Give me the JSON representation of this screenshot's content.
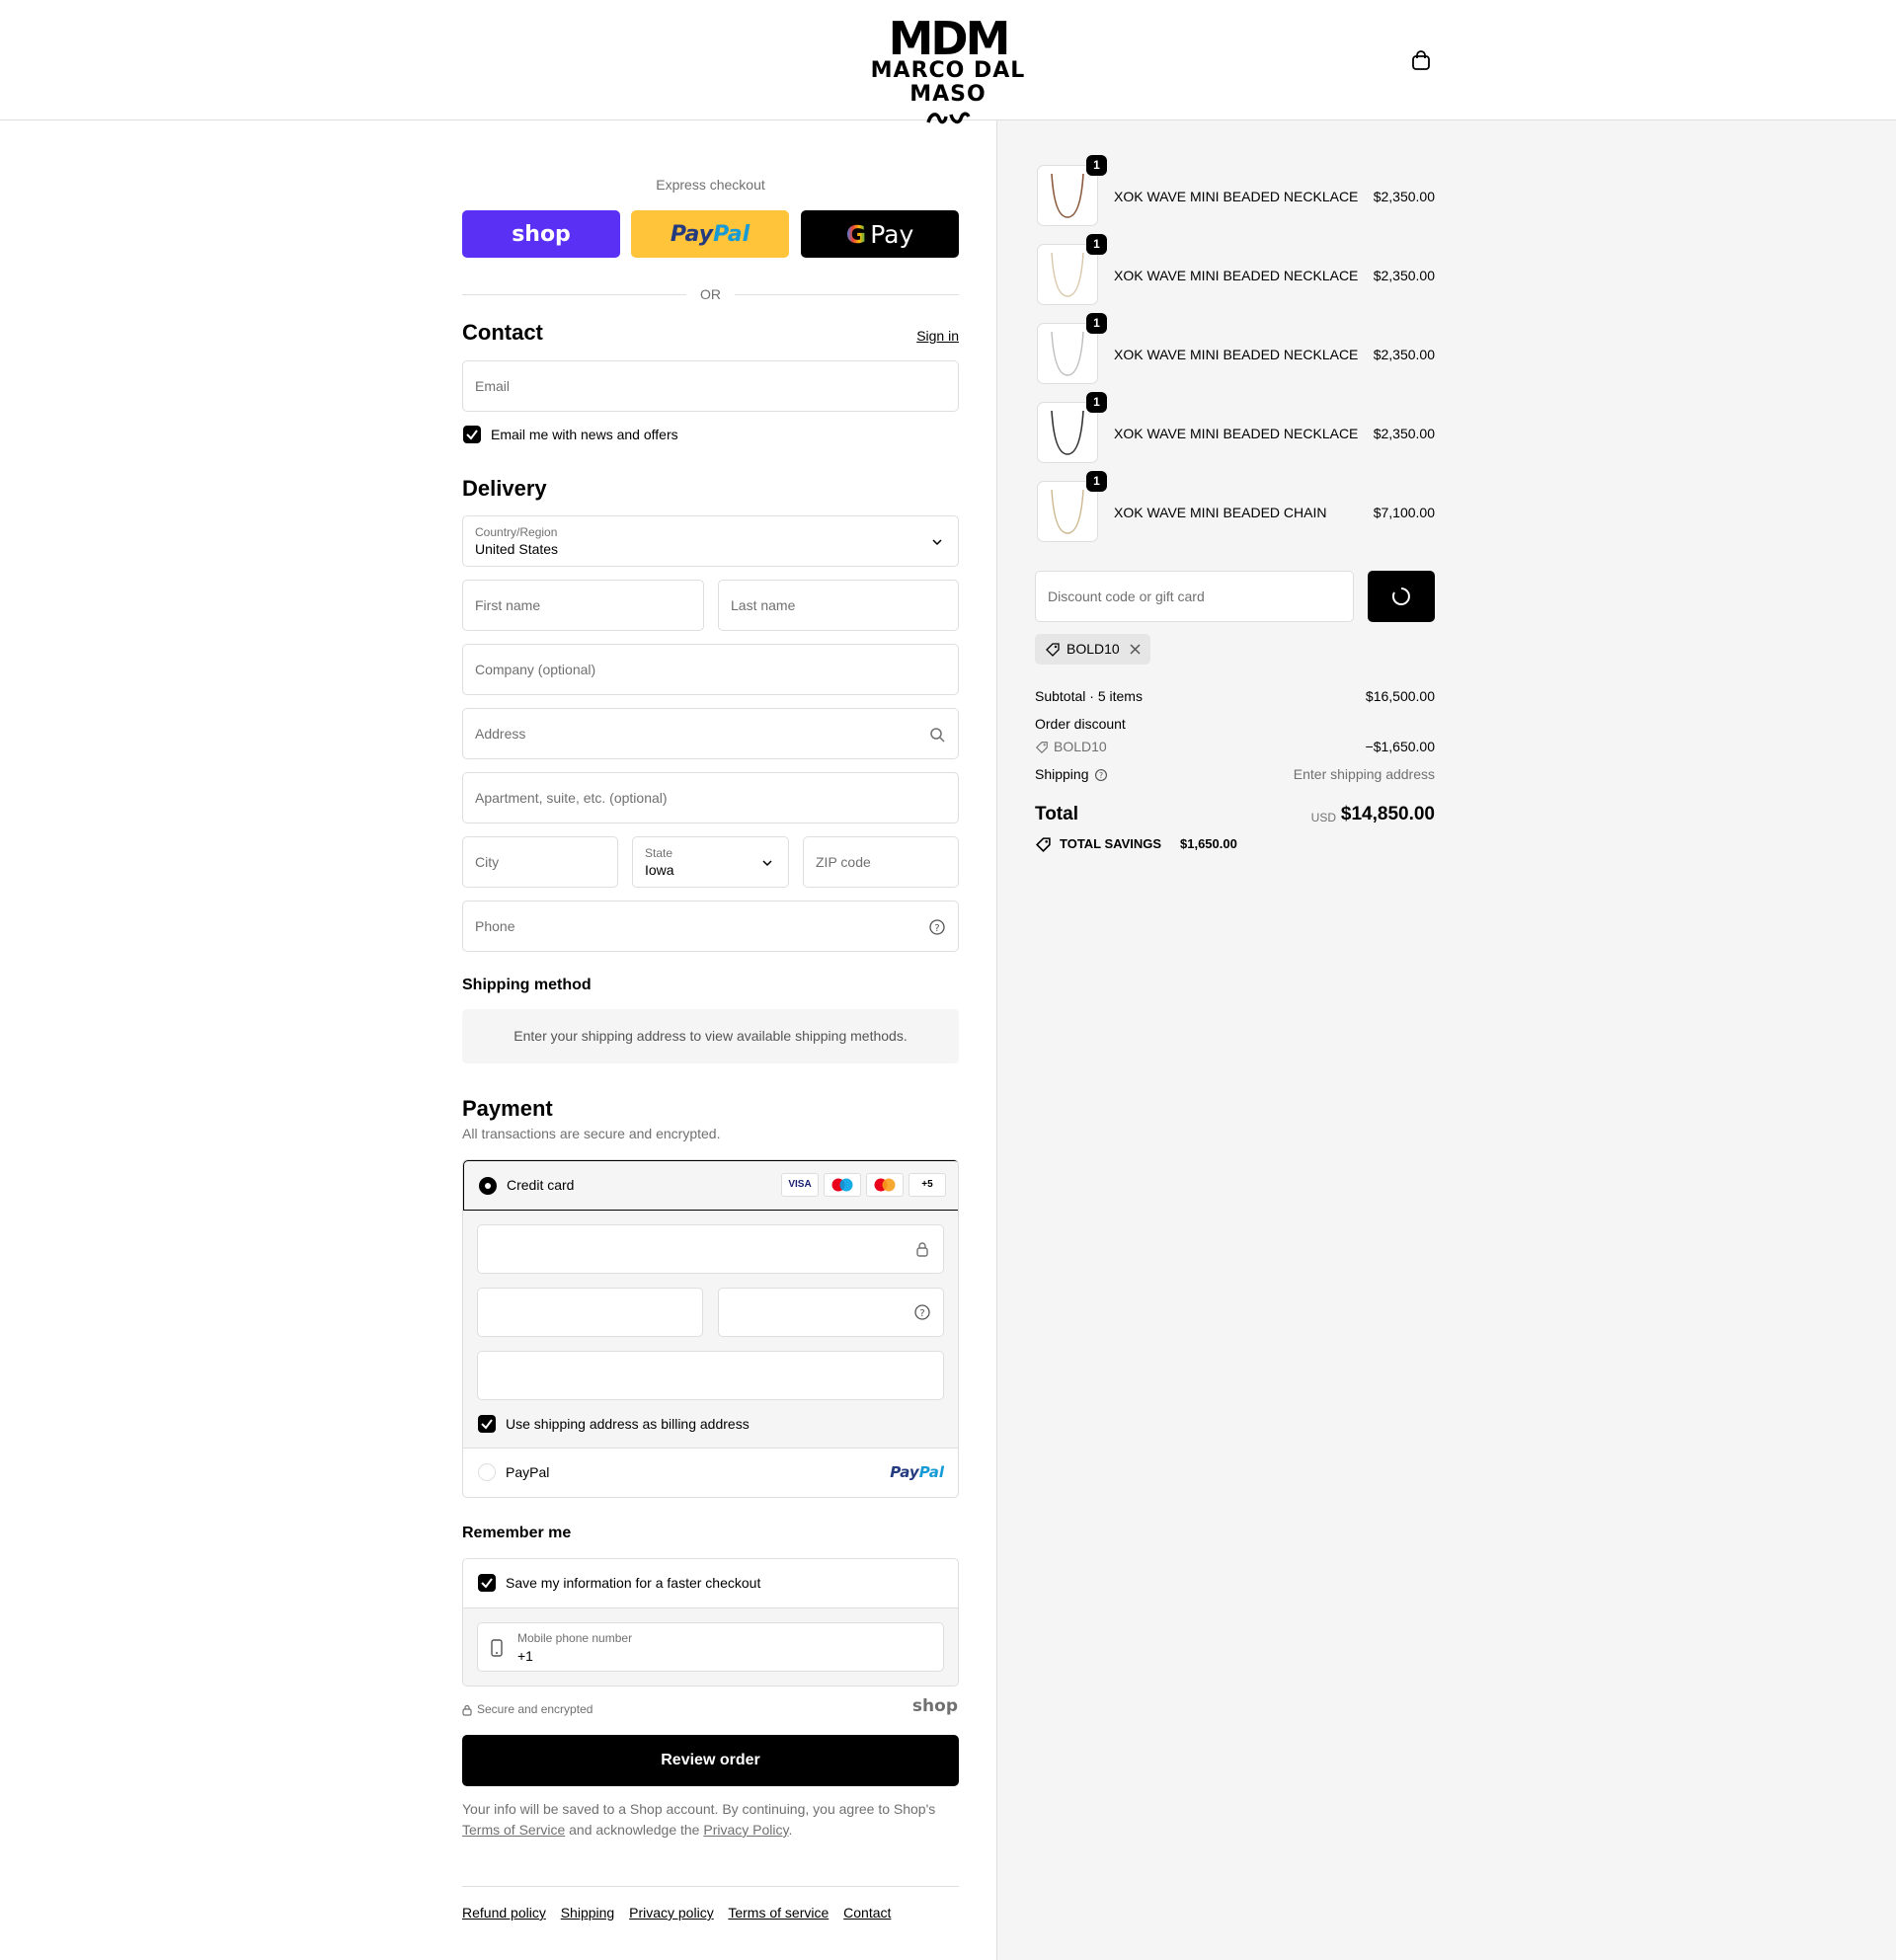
{
  "header": {
    "logo_mark": "MDM",
    "brand": "MARCO DAL MASO",
    "cart_icon": "bag-icon"
  },
  "express": {
    "title": "Express checkout",
    "shop": "shop",
    "paypal_pay": "Pay",
    "paypal_pal": "Pal",
    "gpay": "Pay",
    "or": "OR"
  },
  "contact": {
    "title": "Contact",
    "sign_in": "Sign in",
    "email_placeholder": "Email",
    "news_label": "Email me with news and offers"
  },
  "delivery": {
    "title": "Delivery",
    "country_label": "Country/Region",
    "country_value": "United States",
    "first_name": "First name",
    "last_name": "Last name",
    "company": "Company (optional)",
    "address": "Address",
    "apartment": "Apartment, suite, etc. (optional)",
    "city": "City",
    "state_label": "State",
    "state_value": "Iowa",
    "zip": "ZIP code",
    "phone": "Phone"
  },
  "shipping_method": {
    "title": "Shipping method",
    "message": "Enter your shipping address to view available shipping methods."
  },
  "payment": {
    "title": "Payment",
    "subtitle": "All transactions are secure and encrypted.",
    "credit_card": "Credit card",
    "cards": [
      "VISA",
      "+5"
    ],
    "billing_label": "Use shipping address as billing address",
    "paypal": "PayPal",
    "paypal_logo_pay": "Pay",
    "paypal_logo_pal": "Pal"
  },
  "remember": {
    "title": "Remember me",
    "save_label": "Save my information for a faster checkout",
    "mobile_label": "Mobile phone number",
    "mobile_value": "+1",
    "secure": "Secure and encrypted",
    "shop": "shop"
  },
  "review_button": "Review order",
  "legal": {
    "line1": "Your info will be saved to a Shop account. By continuing, you agree to Shop's",
    "terms": "Terms of Service",
    "middle": "and acknowledge the",
    "privacy": "Privacy Policy",
    "end": "."
  },
  "footer_links": [
    "Refund policy",
    "Shipping",
    "Privacy policy",
    "Terms of service",
    "Contact"
  ],
  "order": {
    "items": [
      {
        "qty": "1",
        "name": "XOK WAVE MINI BEADED NECKLACE",
        "price": "$2,350.00"
      },
      {
        "qty": "1",
        "name": "XOK WAVE MINI BEADED NECKLACE",
        "price": "$2,350.00"
      },
      {
        "qty": "1",
        "name": "XOK WAVE MINI BEADED NECKLACE",
        "price": "$2,350.00"
      },
      {
        "qty": "1",
        "name": "XOK WAVE MINI BEADED NECKLACE",
        "price": "$2,350.00"
      },
      {
        "qty": "1",
        "name": "XOK WAVE MINI BEADED CHAIN",
        "price": "$7,100.00"
      }
    ],
    "discount_placeholder": "Discount code or gift card",
    "applied_code": "BOLD10",
    "subtotal_label": "Subtotal · 5 items",
    "subtotal_value": "$16,500.00",
    "order_discount_label": "Order discount",
    "discount_code": "BOLD10",
    "discount_value": "−$1,650.00",
    "shipping_label": "Shipping",
    "shipping_value": "Enter shipping address",
    "total_label": "Total",
    "currency": "USD",
    "total_value": "$14,850.00",
    "savings_label": "TOTAL SAVINGS",
    "savings_value": "$1,650.00"
  },
  "colors": {
    "shop_purple": "#5a31f4",
    "paypal_yellow": "#ffc439",
    "paypal_dark": "#253b80",
    "paypal_light": "#179bd7",
    "sidebar_bg": "#f5f5f5"
  }
}
